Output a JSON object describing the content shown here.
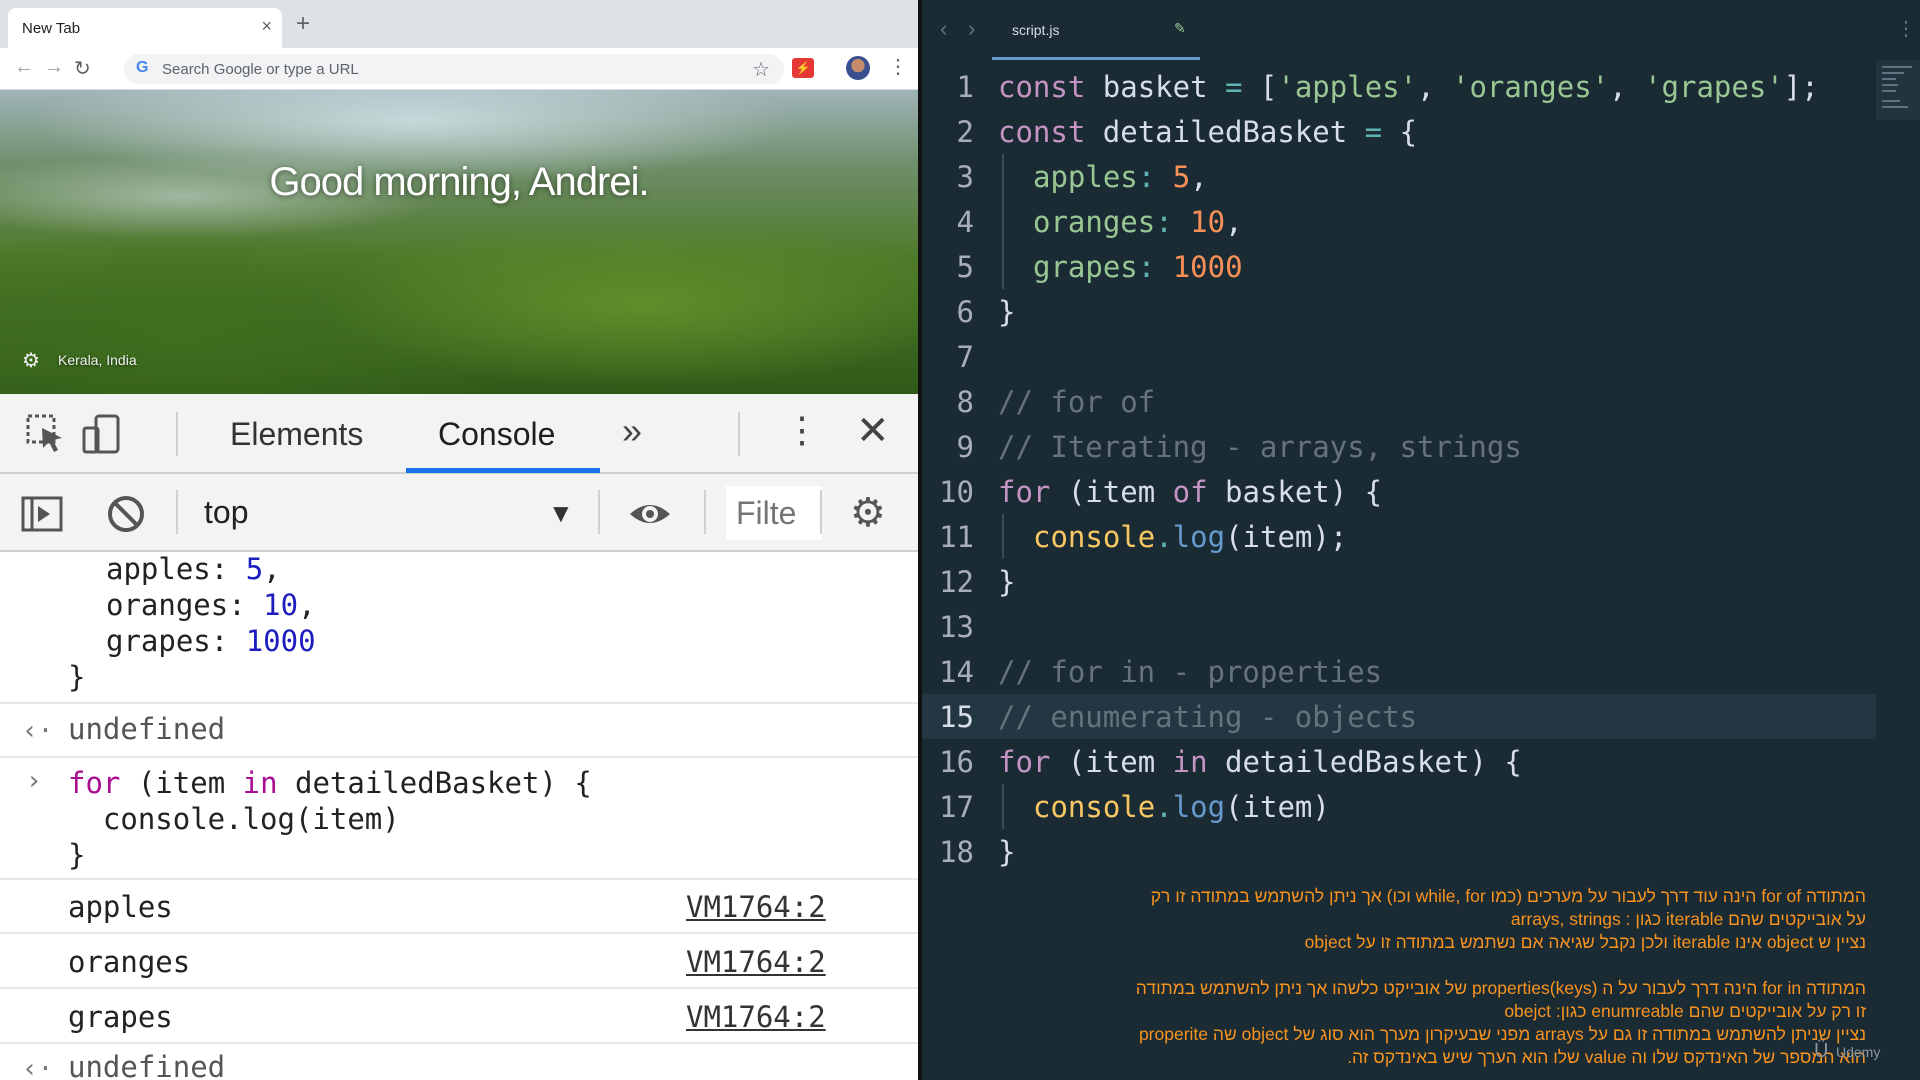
{
  "browser": {
    "tab_title": "New Tab",
    "tab_close": "×",
    "new_tab": "+",
    "omnibox_placeholder": "Search Google or type a URL",
    "greeting": "Good morning, Andrei.",
    "location": "Kerala, India",
    "ext_label": "⚡"
  },
  "devtools": {
    "tabs": [
      "Elements",
      "Console"
    ],
    "active_tab": "Console",
    "more": "»",
    "context": "top",
    "filter_placeholder": "Filter",
    "filter_visible": "Filte"
  },
  "console": {
    "lines": {
      "l1_key": "apples: ",
      "l1_val": "5",
      "l1_end": ",",
      "l2_key": "oranges: ",
      "l2_val": "10",
      "l2_end": ",",
      "l3_key": "grapes: ",
      "l3_val": "1000",
      "l4": "}",
      "undef1": "undefined",
      "in_kw1": "for",
      "in_rest1": " (item ",
      "in_kw2": "in",
      "in_rest2": " detailedBasket) {",
      "in_l2": "  console.log(item)",
      "in_l3": "}",
      "out1": "apples",
      "out2": "oranges",
      "out3": "grapes",
      "link": "VM1764:2",
      "undef2": "undefined"
    }
  },
  "editor": {
    "file": "script.js",
    "line_numbers": [
      "1",
      "2",
      "3",
      "4",
      "5",
      "6",
      "7",
      "8",
      "9",
      "10",
      "11",
      "12",
      "13",
      "14",
      "15",
      "16",
      "17",
      "18"
    ],
    "highlighted_line": 15,
    "code": {
      "l1": [
        "const",
        " basket ",
        "=",
        " [",
        "'apples'",
        ", ",
        "'oranges'",
        ", ",
        "'grapes'",
        "];"
      ],
      "l2": [
        "const",
        " detailedBasket ",
        "=",
        " {"
      ],
      "l3": [
        "apples",
        ":",
        " 5",
        ","
      ],
      "l4": [
        "oranges",
        ":",
        " 10",
        ","
      ],
      "l5": [
        "grapes",
        ":",
        " 1000"
      ],
      "l6": "}",
      "l8": "// for of",
      "l9": "// Iterating - arrays, strings",
      "l10": [
        "for",
        " (item ",
        "of",
        " basket) {"
      ],
      "l11": [
        "console",
        ".",
        "log",
        "(item);"
      ],
      "l12": "}",
      "l14": "// for in - properties",
      "l15": "// enumerating - objects",
      "l16": [
        "for",
        " (item ",
        "in",
        " detailedBasket) {"
      ],
      "l17": [
        "console",
        ".",
        "log",
        "(item)"
      ],
      "l18": "}"
    }
  },
  "notes": [
    "המתודה for of הינה עוד דרך לעבור על מערכים (כמו while, for וכו) אך ניתן להשתמש במתודה זו רק",
    "על אובייקטים שהם iterable כגון : arrays, strings",
    "נציין ש object אינו iterable ולכן נקבל שגיאה אם נשתמש במתודה זו על object",
    "",
    "המתודה for in הינה דרך לעבור על ה properties(keys) של אובייקט כלשהו אך ניתן להשתמש במתודה",
    "זו רק על אובייקטים שהם enumreable כגון: obejct",
    "נציין שניתן להשתמש במתודה זו גם על arrays מפני שבעיקרון מערך הוא סוג של object שה properite",
    "הוא המספר של האינדקס שלו וה value שלו הוא הערך שיש באינדקס זה."
  ],
  "watermark": "Udemy",
  "colors": {
    "editor_bg": "#1b2b34",
    "devtools_accent": "#1a73e8",
    "note_orange": "#f7931e"
  }
}
